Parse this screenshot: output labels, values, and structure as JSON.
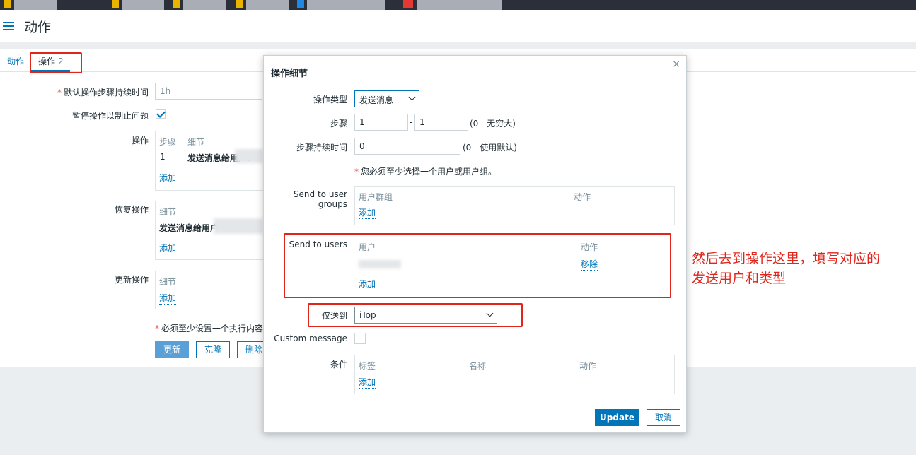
{
  "header": {
    "title": "动作"
  },
  "tabs": [
    {
      "label": "动作"
    },
    {
      "label": "操作",
      "count": "2"
    }
  ],
  "form": {
    "default_duration_label": "默认操作步骤持续时间",
    "default_duration_value": "1h",
    "pause_label": "暂停操作以制止问题",
    "operations_label": "操作",
    "operations_headers": {
      "steps": "步骤",
      "details": "细节"
    },
    "operations_row": {
      "step": "1",
      "details": "发送消息给用户:"
    },
    "recovery_label": "恢复操作",
    "recovery_header": "细节",
    "recovery_row": "发送消息给用户",
    "update_label": "更新操作",
    "update_header": "细节",
    "add_link": "添加",
    "must_note": "必须至少设置一个执行内容",
    "buttons": {
      "update": "更新",
      "clone": "克隆",
      "delete": "删除"
    }
  },
  "modal": {
    "title": "操作细节",
    "close": "×",
    "op_type_label": "操作类型",
    "op_type_value": "发送消息",
    "steps_label": "步骤",
    "step_from": "1",
    "step_sep": "-",
    "step_to": "1",
    "steps_hint": "(0 - 无穷大)",
    "duration_label": "步骤持续时间",
    "duration_value": "0",
    "duration_hint": "(0 - 使用默认)",
    "must_user_note": "您必须至少选择一个用户或用户组。",
    "groups_label": "Send to user groups",
    "groups_headers": {
      "group": "用户群组",
      "action": "动作"
    },
    "users_label": "Send to users",
    "users_headers": {
      "user": "用户",
      "action": "动作"
    },
    "remove_link": "移除",
    "add_link": "添加",
    "only_send_label": "仅送到",
    "only_send_value": "iTop",
    "custom_message_label": "Custom message",
    "conditions_label": "条件",
    "conditions_headers": {
      "tag": "标签",
      "name": "名称",
      "action": "动作"
    },
    "update_button": "Update",
    "cancel_button": "取消"
  },
  "annotation": {
    "line1": "然后去到操作这里，填写对应的",
    "line2": "发送用户和类型"
  },
  "colors": {
    "accent": "#0275b8",
    "annotation_red": "#e0251b",
    "primary_button": "#0275b8"
  }
}
